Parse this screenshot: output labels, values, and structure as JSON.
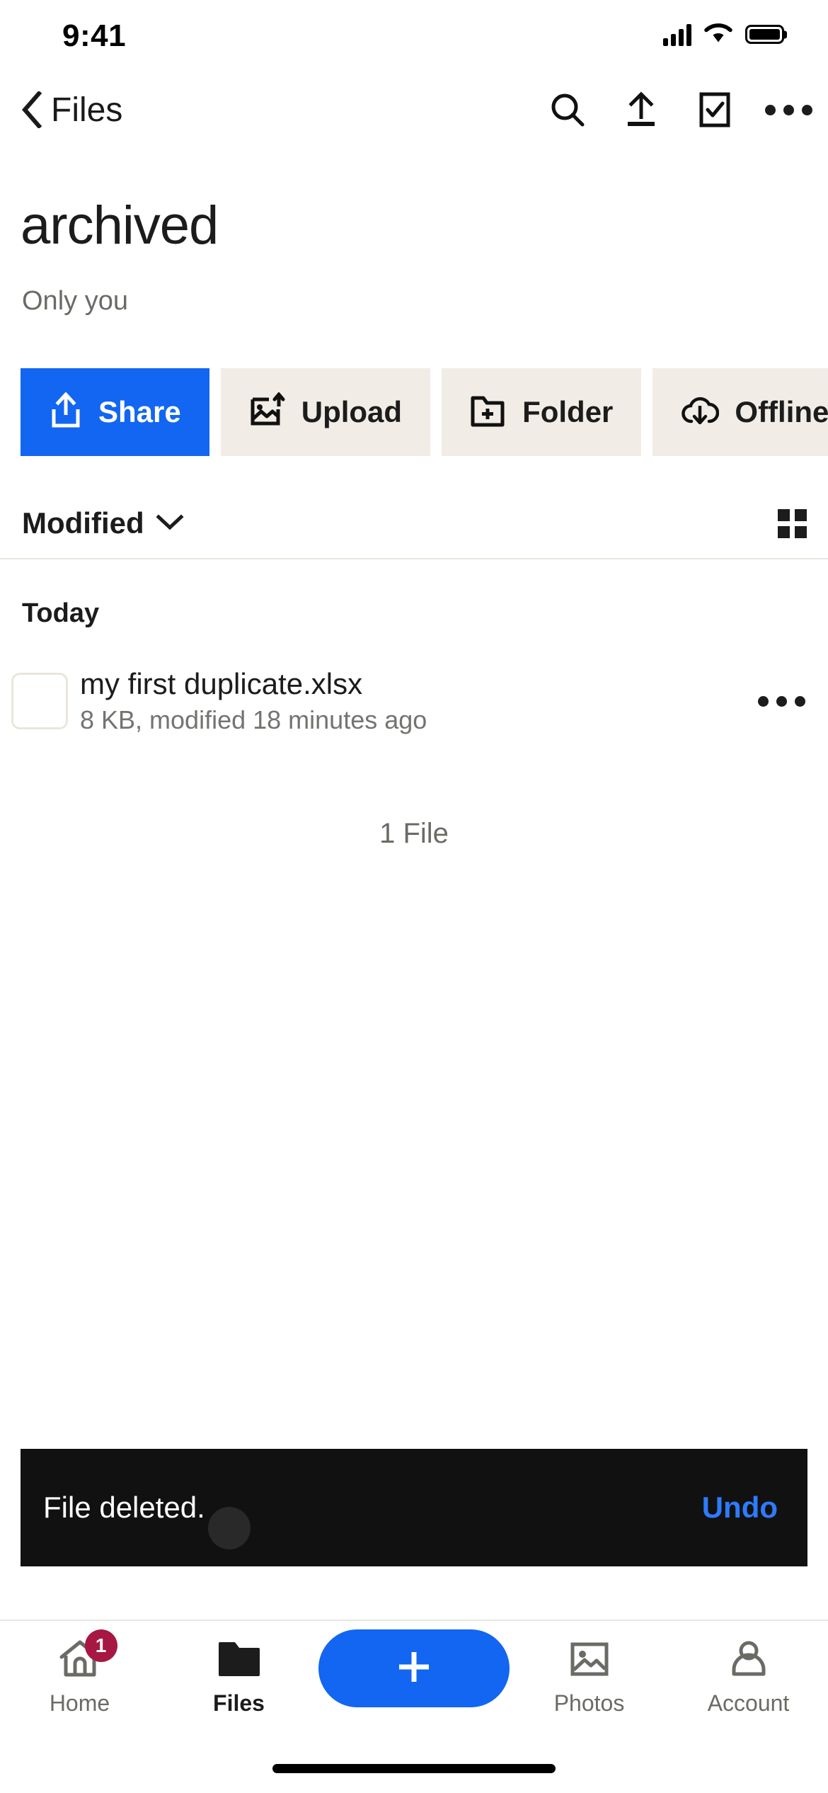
{
  "status_bar": {
    "time": "9:41",
    "cellular_icon": "cellular-signal-icon",
    "wifi_icon": "wifi-icon",
    "battery_icon": "battery-full-icon",
    "battery_level_percent": 100
  },
  "nav_bar": {
    "back_label": "Files",
    "back_icon": "chevron-left-icon",
    "actions": [
      {
        "name": "search",
        "icon": "search-icon"
      },
      {
        "name": "upload",
        "icon": "upload-arrow-icon"
      },
      {
        "name": "select",
        "icon": "checkbox-select-icon"
      },
      {
        "name": "more",
        "icon": "ellipsis-horizontal-icon"
      }
    ]
  },
  "header": {
    "title": "archived",
    "subtitle": "Only you"
  },
  "action_buttons": [
    {
      "label": "Share",
      "icon": "share-upload-icon",
      "primary": true
    },
    {
      "label": "Upload",
      "icon": "image-upload-icon",
      "primary": false
    },
    {
      "label": "Folder",
      "icon": "folder-plus-icon",
      "primary": false
    },
    {
      "label": "Offline",
      "icon": "cloud-download-icon",
      "primary": false
    }
  ],
  "sort_row": {
    "sort_label": "Modified",
    "chevron_icon": "chevron-down-icon",
    "view_toggle_icon": "grid-view-icon"
  },
  "list": {
    "group_header": "Today",
    "files": [
      {
        "name": "my first duplicate.xlsx",
        "meta": "8 KB, modified 18 minutes ago",
        "thumbnail_icon": "file-thumbnail-placeholder",
        "more_icon": "ellipsis-horizontal-icon"
      }
    ],
    "footer_count": "1 File"
  },
  "snackbar": {
    "message": "File deleted.",
    "action_label": "Undo",
    "background_color": "#111111",
    "action_color": "#2e7bfb"
  },
  "tab_bar": {
    "items": [
      {
        "label": "Home",
        "icon": "home-icon",
        "active": false,
        "badge": "1"
      },
      {
        "label": "Files",
        "icon": "folder-icon",
        "active": true,
        "badge": ""
      },
      {
        "label": "Photos",
        "icon": "photo-icon",
        "active": false,
        "badge": ""
      },
      {
        "label": "Account",
        "icon": "person-icon",
        "active": false,
        "badge": ""
      }
    ],
    "fab": {
      "icon": "plus-icon",
      "color": "#1266F1"
    },
    "badge_color": "#A61744"
  },
  "theme": {
    "accent_blue": "#1266F1",
    "chip_background": "#F1EDE6",
    "text_primary": "#1c1c1c",
    "text_secondary": "#6b6b66"
  }
}
